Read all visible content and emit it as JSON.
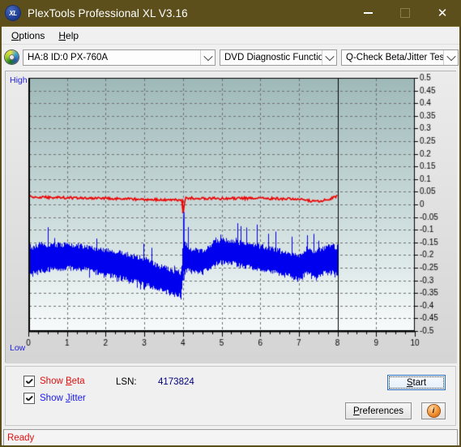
{
  "window": {
    "title": "PlexTools Professional XL V3.16",
    "app_icon": "xl-logo-icon",
    "minimize_label": "–",
    "maximize_label": "□",
    "close_label": "✕",
    "titlebar_color": "#5c4f1c"
  },
  "menubar": {
    "items": [
      {
        "label": "Options",
        "accel": "O"
      },
      {
        "label": "Help",
        "accel": "H"
      }
    ]
  },
  "toolbar": {
    "drive_icon": "cd-disc-icon",
    "drive_select": {
      "value": "HA:8 ID:0  PX-760A",
      "options": [
        "HA:8 ID:0  PX-760A"
      ]
    },
    "function_select": {
      "value": "DVD Diagnostic Functions",
      "options": [
        "DVD Diagnostic Functions"
      ]
    },
    "test_select": {
      "value": "Q-Check Beta/Jitter Test",
      "options": [
        "Q-Check Beta/Jitter Test"
      ]
    }
  },
  "graph": {
    "high_label": "High",
    "low_label": "Low",
    "high_label_color": "#2222dd",
    "low_label_color": "#2222dd"
  },
  "controls": {
    "show_beta": {
      "label": "Show Beta",
      "accel": "B",
      "checked": true,
      "color": "#e01010"
    },
    "show_jitter": {
      "label": "Show Jitter",
      "accel": "J",
      "checked": true,
      "color": "#1a1aee"
    },
    "lsn_label": "LSN:",
    "lsn_value": "4173824",
    "start_button": {
      "label": "Start",
      "accel": "S",
      "focused": true
    },
    "preferences_button": {
      "label": "Preferences",
      "accel": "P"
    },
    "info_button": {
      "label": "i",
      "icon": "info-icon"
    }
  },
  "statusbar": {
    "text": "Ready",
    "color": "#e01010"
  },
  "chart_data": {
    "type": "line",
    "title": "Q-Check Beta/Jitter Test",
    "xlabel": "",
    "ylabel": "",
    "xlim": [
      0,
      10
    ],
    "ylim": [
      -0.5,
      0.5
    ],
    "grid": true,
    "legend_position": "bottom-left",
    "x_ticks": [
      0,
      1,
      2,
      3,
      4,
      5,
      6,
      7,
      8,
      9,
      10
    ],
    "x_tick_labels": [
      "0",
      "1",
      "2",
      "3",
      "4",
      "5",
      "6",
      "7",
      "8",
      "9",
      "10"
    ],
    "x_minor_step": 0.25,
    "y_ticks": [
      0.5,
      0.45,
      0.4,
      0.35,
      0.3,
      0.25,
      0.2,
      0.15,
      0.1,
      0.05,
      0,
      -0.05,
      -0.1,
      -0.15,
      -0.2,
      -0.25,
      -0.3,
      -0.35,
      -0.4,
      -0.45,
      -0.5
    ],
    "y_tick_labels": [
      "0.5",
      "0.45",
      "0.4",
      "0.35",
      "0.3",
      "0.25",
      "0.2",
      "0.15",
      "0.1",
      "0.05",
      "0",
      "-0.05",
      "-0.1",
      "-0.15",
      "-0.2",
      "-0.25",
      "-0.3",
      "-0.35",
      "-0.4",
      "-0.45",
      "-0.5"
    ],
    "y_axis_side": "right",
    "plot_bg_gradient": [
      "#9fb9b9",
      "#f8fbfb"
    ],
    "gridline_color": "#707070",
    "gridline_style": "dashed",
    "data_end_x": 8.0,
    "data_end_marker": "vertical-line",
    "series": [
      {
        "name": "Show Beta",
        "color": "#ee0000",
        "type": "noisy-line",
        "x": [
          0.0,
          0.5,
          1.0,
          1.5,
          2.0,
          2.5,
          3.0,
          3.5,
          3.95,
          4.0,
          4.05,
          4.5,
          5.0,
          5.5,
          6.0,
          6.5,
          7.0,
          7.3,
          7.5,
          7.7,
          7.9,
          8.0
        ],
        "y": [
          0.03,
          0.028,
          0.026,
          0.025,
          0.024,
          0.022,
          0.02,
          0.018,
          0.017,
          -0.03,
          0.026,
          0.024,
          0.023,
          0.024,
          0.024,
          0.023,
          0.021,
          0.014,
          0.013,
          0.018,
          0.028,
          0.036
        ],
        "noise_amplitude": 0.01
      },
      {
        "name": "Show Jitter",
        "color": "#0000ee",
        "type": "noise-band",
        "x": [
          0.0,
          0.1,
          0.3,
          0.6,
          1.0,
          1.4,
          1.8,
          2.2,
          2.6,
          3.0,
          3.3,
          3.55,
          3.75,
          3.95,
          4.0,
          4.2,
          4.5,
          4.8,
          5.0,
          5.3,
          5.6,
          6.0,
          6.4,
          6.8,
          7.0,
          7.2,
          7.4,
          7.6,
          7.8,
          8.0
        ],
        "y_upper": [
          -0.205,
          -0.17,
          -0.155,
          -0.16,
          -0.16,
          -0.165,
          -0.175,
          -0.185,
          -0.2,
          -0.215,
          -0.24,
          -0.25,
          -0.265,
          -0.27,
          -0.14,
          -0.18,
          -0.185,
          -0.15,
          -0.14,
          -0.145,
          -0.155,
          -0.165,
          -0.18,
          -0.195,
          -0.2,
          -0.175,
          -0.185,
          -0.175,
          -0.165,
          -0.17
        ],
        "y_lower": [
          -0.275,
          -0.275,
          -0.265,
          -0.255,
          -0.25,
          -0.255,
          -0.27,
          -0.285,
          -0.3,
          -0.315,
          -0.335,
          -0.345,
          -0.355,
          -0.36,
          -0.255,
          -0.265,
          -0.27,
          -0.24,
          -0.23,
          -0.235,
          -0.245,
          -0.255,
          -0.27,
          -0.285,
          -0.3,
          -0.27,
          -0.28,
          -0.275,
          -0.27,
          -0.27
        ],
        "spike_probability": 0.1,
        "spike_extra": 0.085
      }
    ],
    "annotations": [
      {
        "text": "High",
        "position": "top-left-outside",
        "color": "#2222dd"
      },
      {
        "text": "Low",
        "position": "bottom-left-outside",
        "color": "#2222dd"
      }
    ]
  }
}
